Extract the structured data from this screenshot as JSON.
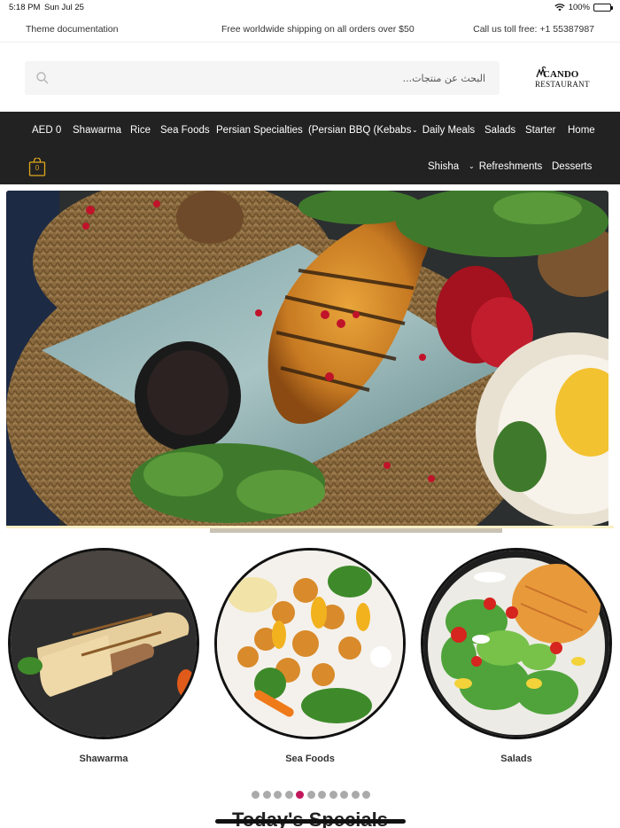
{
  "status_bar": {
    "time": "5:18 PM",
    "date": "Sun Jul 25",
    "battery": "100%",
    "icons": [
      "wifi-icon",
      "battery-icon"
    ]
  },
  "top_info": {
    "left_link": "Theme documentation",
    "shipping_notice": "Free worldwide shipping on all orders over $50",
    "phone_text": "Call us toll free: +1 55387987"
  },
  "header": {
    "search_placeholder": "البحث عن منتجات...",
    "logo_main": "CANDO",
    "logo_sub": "RESTAURANT"
  },
  "nav": {
    "row1": [
      {
        "label": "Home"
      },
      {
        "label": "Starter"
      },
      {
        "label": "Salads"
      },
      {
        "label": "Daily Meals",
        "dropdown": true
      },
      {
        "label": "(Persian BBQ (Kebabs"
      },
      {
        "label": "Persian Specialties"
      },
      {
        "label": "Sea Foods"
      },
      {
        "label": "Rice"
      },
      {
        "label": "Shawarma"
      },
      {
        "label": "AED 0"
      }
    ],
    "row2": [
      {
        "label": "Desserts"
      },
      {
        "label": "Refreshments",
        "dropdown": true
      },
      {
        "label": "Shisha"
      }
    ],
    "cart_count": "0"
  },
  "categories": [
    {
      "label": "Shawarma"
    },
    {
      "label": "Sea Foods"
    },
    {
      "label": "Salads"
    }
  ],
  "carousel": {
    "dot_count": 11,
    "active_index": 4
  },
  "section_title": "Today's Specials",
  "colors": {
    "nav_bg": "#222222",
    "accent_dot": "#c2185b",
    "cart_accent": "#e0a81c"
  }
}
